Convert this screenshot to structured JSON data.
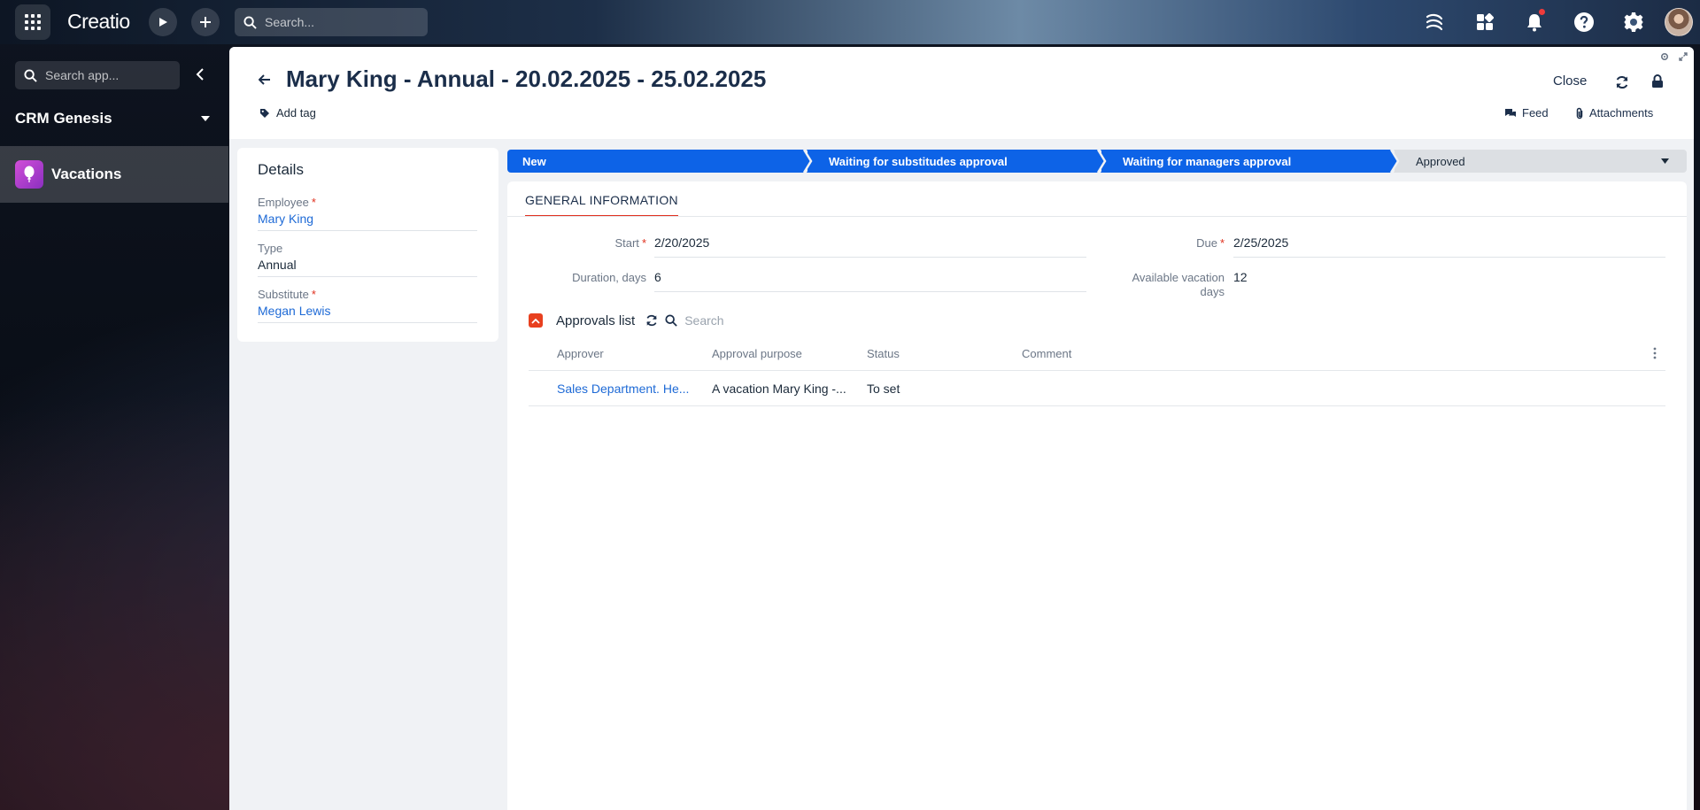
{
  "app": {
    "logo": "Creatio"
  },
  "topbar": {
    "search_placeholder": "Search..."
  },
  "sidebar": {
    "search_placeholder": "Search app...",
    "workspace": "CRM Genesis",
    "items": [
      {
        "label": "Vacations",
        "active": true
      }
    ]
  },
  "header": {
    "title": "Mary King - Annual - 20.02.2025 - 25.02.2025",
    "add_tag": "Add tag",
    "close": "Close",
    "feed": "Feed",
    "attachments": "Attachments"
  },
  "details": {
    "title": "Details",
    "fields": [
      {
        "label": "Employee",
        "value": "Mary King",
        "required": true,
        "link": true
      },
      {
        "label": "Type",
        "value": "Annual",
        "required": false,
        "link": false
      },
      {
        "label": "Substitute",
        "value": "Megan Lewis",
        "required": true,
        "link": true
      }
    ]
  },
  "stages": [
    {
      "label": "New",
      "state": "active"
    },
    {
      "label": "Waiting for substitudes approval",
      "state": "active"
    },
    {
      "label": "Waiting for managers approval",
      "state": "active"
    },
    {
      "label": "Approved",
      "state": "inactive"
    }
  ],
  "form": {
    "tab": "GENERAL INFORMATION",
    "start_label": "Start",
    "start_value": "2/20/2025",
    "due_label": "Due",
    "due_value": "2/25/2025",
    "duration_label": "Duration, days",
    "duration_value": "6",
    "available_label_1": "Available vacation",
    "available_label_2": "days",
    "available_value": "12"
  },
  "approvals": {
    "title": "Approvals list",
    "search_placeholder": "Search",
    "columns": [
      "Approver",
      "Approval purpose",
      "Status",
      "Comment"
    ],
    "rows": [
      {
        "approver": "Sales Department. He...",
        "purpose": "A vacation Mary King -...",
        "status": "To set",
        "comment": ""
      }
    ]
  },
  "colors": {
    "stage_active": "#0d63e7",
    "required": "#e0301e",
    "link": "#1e6ad6",
    "accent": "#e8401f"
  }
}
